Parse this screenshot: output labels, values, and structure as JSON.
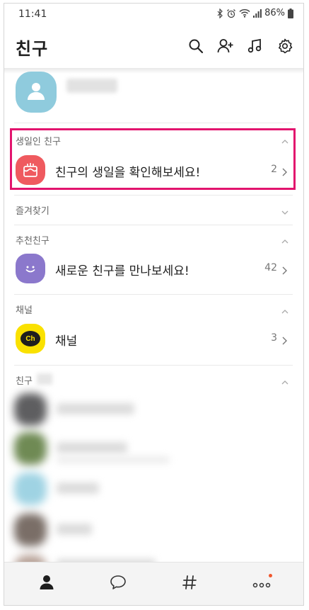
{
  "status_bar": {
    "time": "11:41",
    "battery": "86%"
  },
  "header": {
    "title": "친구"
  },
  "sections": {
    "birthday": {
      "title": "생일인 친구",
      "label": "친구의 생일을 확인해보세요!",
      "count": "2"
    },
    "favorites": {
      "title": "즐겨찾기"
    },
    "recommended": {
      "title": "추천친구",
      "label": "새로운 친구를 만나보세요!",
      "count": "42"
    },
    "channel": {
      "title": "채널",
      "label": "채널",
      "count": "3",
      "icon_text": "Ch"
    },
    "friends": {
      "title": "친구"
    }
  },
  "colors": {
    "highlight": "#e2146e",
    "birthday_icon": "#ef5a5f",
    "recommend_icon": "#8b78cc",
    "channel_icon": "#fae100",
    "profile_avatar": "#8fcbdd"
  },
  "icons": {
    "header": [
      "search-icon",
      "add-friend-icon",
      "music-icon",
      "settings-icon"
    ],
    "nav": [
      "friends-tab-icon",
      "chat-tab-icon",
      "hashtag-tab-icon",
      "more-tab-icon"
    ]
  }
}
